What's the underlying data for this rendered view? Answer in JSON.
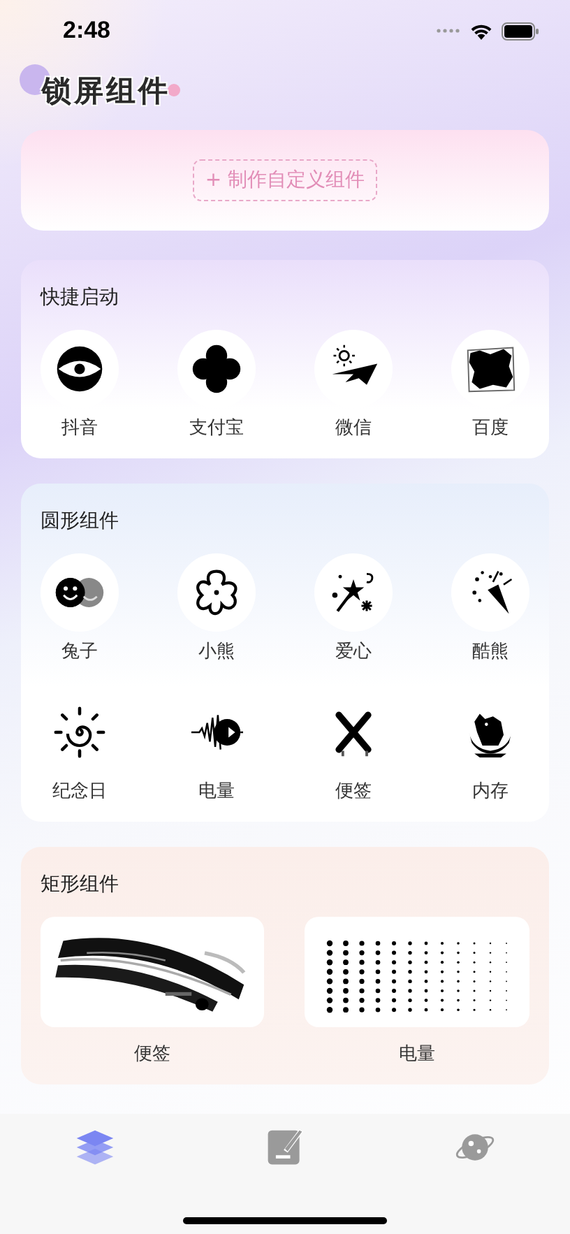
{
  "status_bar": {
    "time": "2:48"
  },
  "title": "锁屏组件",
  "create_button": {
    "label": "+ 制作自定义组件"
  },
  "sections": [
    {
      "kind": "icons",
      "title": "快捷启动",
      "items": [
        {
          "label": "抖音"
        },
        {
          "label": "支付宝"
        },
        {
          "label": "微信"
        },
        {
          "label": "百度"
        }
      ]
    },
    {
      "kind": "icons",
      "title": "圆形组件",
      "items": [
        {
          "label": "兔子"
        },
        {
          "label": "小熊"
        },
        {
          "label": "爱心"
        },
        {
          "label": "酷熊"
        },
        {
          "label": "纪念日"
        },
        {
          "label": "电量"
        },
        {
          "label": "便签"
        },
        {
          "label": "内存"
        }
      ]
    },
    {
      "kind": "cards",
      "title": "矩形组件",
      "items": [
        {
          "label": "便签"
        },
        {
          "label": "电量"
        }
      ]
    }
  ],
  "tab_bar": [
    {
      "selected": true
    },
    {
      "selected": false
    },
    {
      "selected": false
    }
  ]
}
